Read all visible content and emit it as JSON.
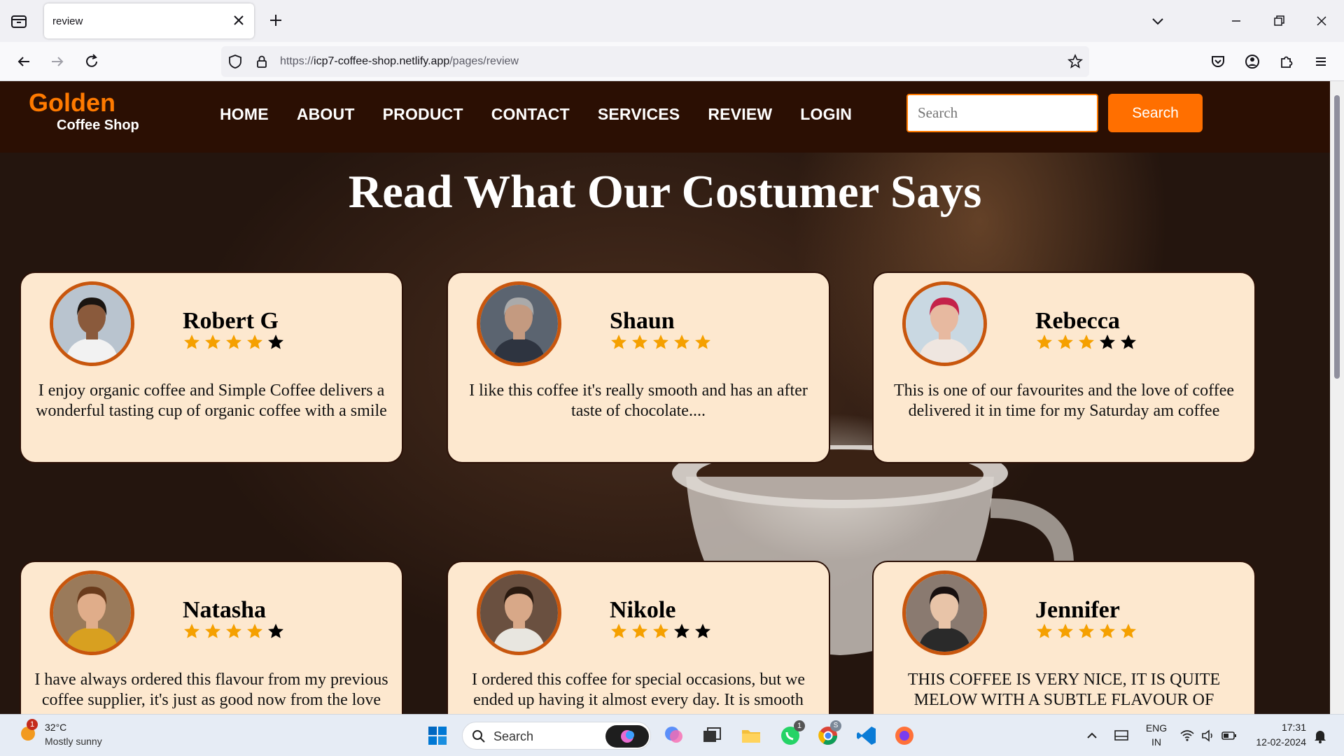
{
  "browser": {
    "tab_title": "review",
    "url_prefix": "https://",
    "url_host": "icp7-coffee-shop.netlify.app",
    "url_path": "/pages/review"
  },
  "site": {
    "logo_main": "Golden",
    "logo_sub": "Coffee Shop",
    "menu": [
      "HOME",
      "ABOUT",
      "PRODUCT",
      "CONTACT",
      "SERVICES",
      "REVIEW",
      "LOGIN"
    ],
    "search_placeholder": "Search",
    "search_button": "Search",
    "heading": "Read What Our Costumer Says",
    "colors": {
      "accent": "#ff7a00",
      "header_bg": "#2b0f03",
      "card_bg": "#fde8cf",
      "star_filled": "#f5a000",
      "star_empty": "#000000"
    }
  },
  "reviews": [
    {
      "name": "Robert G",
      "rating": 4,
      "text": "I enjoy organic coffee and Simple Coffee delivers a wonderful tasting cup of organic coffee with a smile"
    },
    {
      "name": "Shaun",
      "rating": 5,
      "text": "I like this coffee it's really smooth and has an after taste of chocolate...."
    },
    {
      "name": "Rebecca",
      "rating": 3,
      "text": "This is one of our favourites and the love of coffee delivered it in time for my Saturday am coffee"
    },
    {
      "name": "Natasha",
      "rating": 4,
      "text": "I have always ordered this flavour from my previous coffee supplier, it's just as good now from the love"
    },
    {
      "name": "Nikole",
      "rating": 3,
      "text": "I ordered this coffee for special occasions, but we ended up having it almost every day. It is smooth"
    },
    {
      "name": "Jennifer",
      "rating": 5,
      "text": "THIS COFFEE IS VERY NICE, IT IS QUITE MELOW WITH A SUBTLE FLAVOUR OF"
    }
  ],
  "taskbar": {
    "weather_temp": "32°C",
    "weather_cond": "Mostly sunny",
    "weather_badge": "1",
    "search_label": "Search",
    "whatsapp_badge": "1",
    "chrome_badge": "S",
    "lang_top": "ENG",
    "lang_bottom": "IN",
    "time": "17:31",
    "date": "12-02-2024"
  }
}
